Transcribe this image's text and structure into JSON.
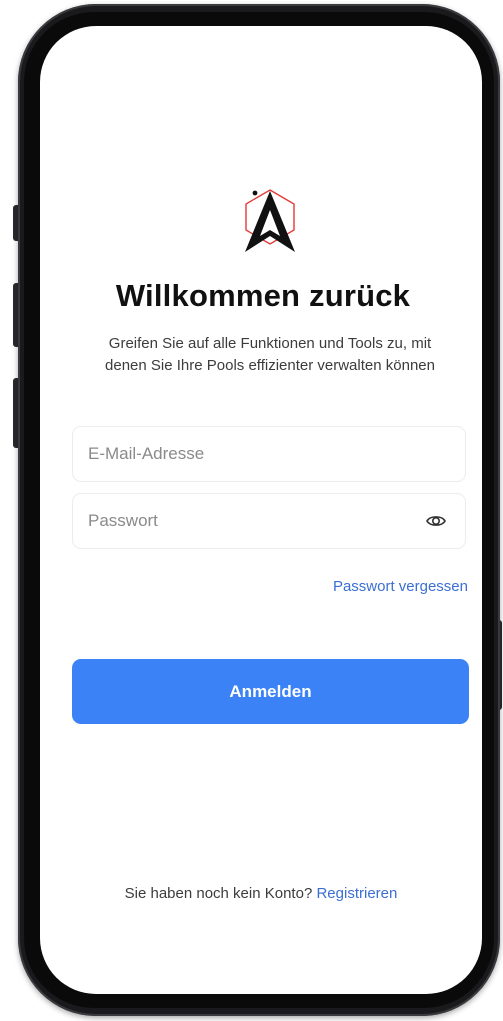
{
  "app": {
    "title": "Willkommen zurück",
    "subtitle_line1": "Greifen Sie auf alle Funktionen und Tools zu, mit",
    "subtitle_line2": "denen Sie Ihre Pools effizienter verwalten können"
  },
  "login_form": {
    "email_placeholder": "E-Mail-Adresse",
    "email_value": "",
    "password_placeholder": "Passwort",
    "password_value": "",
    "password_toggle_icon": "eye-icon",
    "forgot_password_label": "Passwort vergessen",
    "submit_label": "Anmelden"
  },
  "footer": {
    "no_account_text": "Sie haben noch kein Konto?",
    "register_label": "Registrieren"
  },
  "brand": {
    "logo_icon": "compass-arrow-logo",
    "logo_accent_color": "#e53935",
    "logo_color": "#111111"
  },
  "colors": {
    "primary": "#3b82f6",
    "link": "#3b6fd4",
    "text": "#111111",
    "muted_text": "#3c3c3c",
    "placeholder": "#8a8a8a"
  }
}
